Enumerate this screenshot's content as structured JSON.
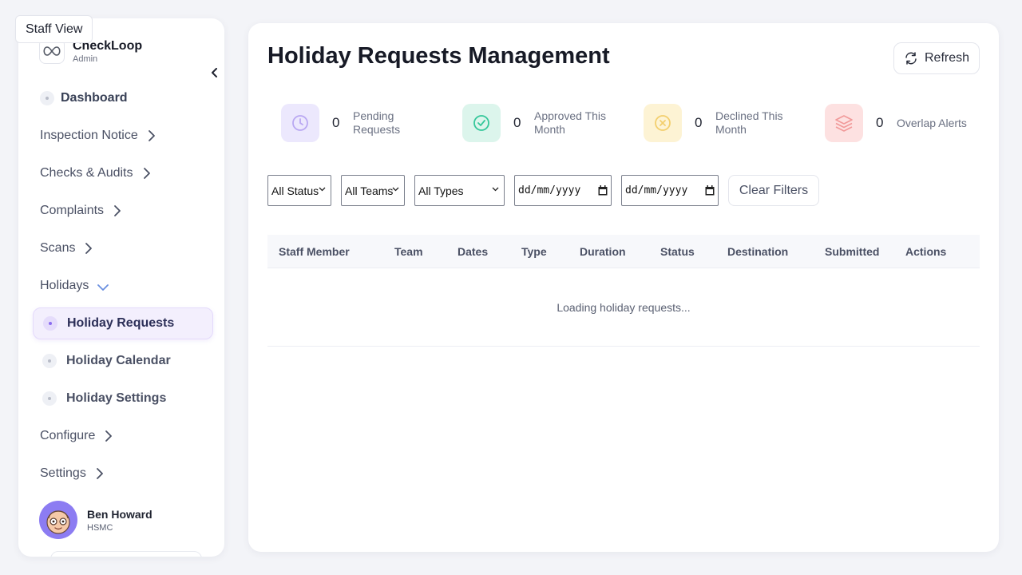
{
  "staff_view": "Staff View",
  "brand": {
    "name": "CheckLoop",
    "role": "Admin"
  },
  "nav": {
    "dashboard": "Dashboard",
    "inspection_notice": "Inspection Notice",
    "checks_audits": "Checks & Audits",
    "complaints": "Complaints",
    "scans": "Scans",
    "holidays": "Holidays",
    "holiday_requests": "Holiday Requests",
    "holiday_calendar": "Holiday Calendar",
    "holiday_settings": "Holiday Settings",
    "configure": "Configure",
    "settings": "Settings"
  },
  "user": {
    "name": "Ben Howard",
    "org": "HSMC"
  },
  "page": {
    "title": "Holiday Requests Management",
    "refresh_label": "Refresh"
  },
  "stats": [
    {
      "value": "0",
      "label": "Pending Requests",
      "icon": "clock-icon",
      "bg": "#ece8fd",
      "fg": "#b9a8f2"
    },
    {
      "value": "0",
      "label": "Approved This Month",
      "icon": "check-circle-icon",
      "bg": "#dcf5ec",
      "fg": "#34c79a"
    },
    {
      "value": "0",
      "label": "Declined This Month",
      "icon": "x-circle-icon",
      "bg": "#fdf3d4",
      "fg": "#f3cf6e"
    },
    {
      "value": "0",
      "label": "Overlap Alerts",
      "icon": "layers-icon",
      "bg": "#fde1e1",
      "fg": "#f19a9a"
    }
  ],
  "filters": {
    "status": "All Status",
    "teams": "All Teams",
    "types": "All Types",
    "date_from": "dd/mm/yyyy",
    "date_to": "dd/mm/yyyy",
    "clear_label": "Clear Filters"
  },
  "table": {
    "columns": [
      "Staff Member",
      "Team",
      "Dates",
      "Type",
      "Duration",
      "Status",
      "Destination",
      "Submitted",
      "Actions"
    ],
    "loading_text": "Loading holiday requests..."
  },
  "colors": {
    "accent": "#8b6cf0",
    "active_bg": "#f3effd"
  }
}
